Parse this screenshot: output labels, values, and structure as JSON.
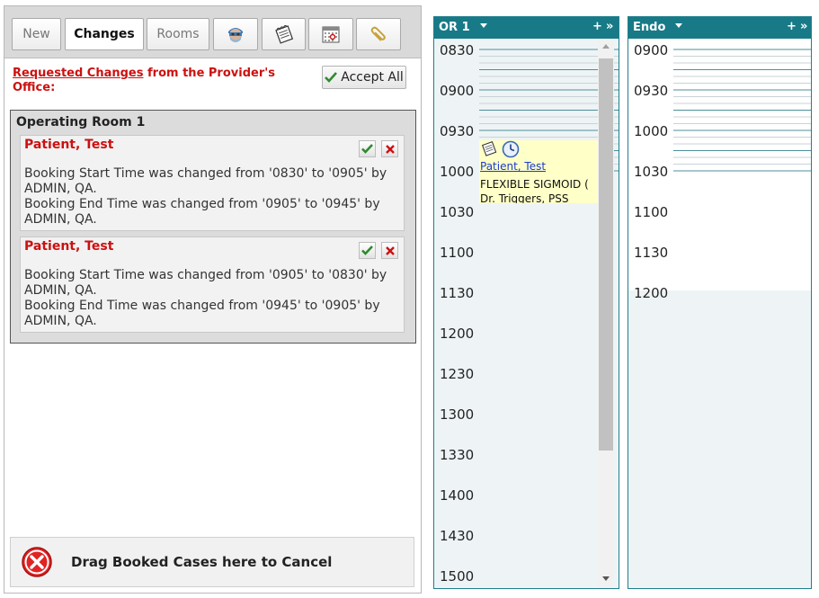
{
  "toolbar": {
    "new_label": "New",
    "changes_label": "Changes",
    "rooms_label": "Rooms",
    "icons": [
      "surgeon-icon",
      "notepad-icon",
      "calendar-icon",
      "paperclip-icon"
    ]
  },
  "requests": {
    "link_text": "Requested Changes",
    "suffix_text": " from the Provider's Office:",
    "accept_all_label": "Accept All"
  },
  "room": {
    "title": "Operating Room 1",
    "changes": [
      {
        "patient": "Patient, Test",
        "lines": [
          "Booking Start Time was changed from '0830' to '0905' by ADMIN, QA.",
          "Booking End Time was changed from '0905' to '0945' by ADMIN, QA."
        ]
      },
      {
        "patient": "Patient, Test",
        "lines": [
          "Booking Start Time was changed from '0905' to '0830' by ADMIN, QA.",
          "Booking End Time was changed from '0945' to '0905' by ADMIN, QA."
        ]
      }
    ]
  },
  "cancel_drop": {
    "label": "Drag Booked Cases here to Cancel"
  },
  "calendars": [
    {
      "title": "OR 1",
      "plus": "+",
      "more": "»",
      "times": [
        "0830",
        "0900",
        "0930",
        "1000",
        "1030",
        "1100",
        "1130",
        "1200",
        "1230",
        "1300",
        "1330",
        "1400",
        "1430",
        "1500"
      ],
      "booked_case": {
        "patient": "Patient, Test",
        "procedure": "FLEXIBLE SIGMOID (",
        "doctor": "Dr. Triggers, PSS"
      }
    },
    {
      "title": "Endo",
      "plus": "+",
      "more": "»",
      "times": [
        "0900",
        "0930",
        "1000",
        "1030",
        "1100",
        "1130",
        "1200"
      ]
    }
  ],
  "colors": {
    "accent_teal": "#187a87",
    "alert_red": "#cc1010",
    "booked_bg": "#ffffc8"
  }
}
